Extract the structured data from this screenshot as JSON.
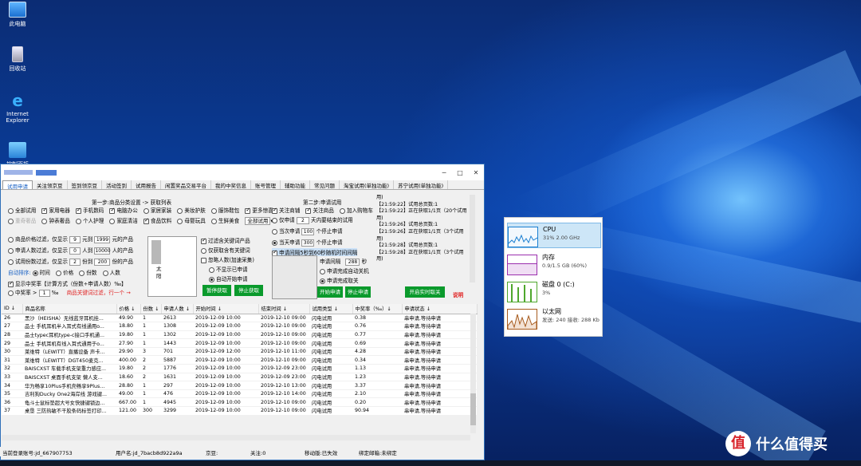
{
  "desktop": {
    "icons": [
      {
        "label": "此电脑",
        "icon": "computer-icon"
      },
      {
        "label": "回收站",
        "icon": "recycle-bin-icon"
      },
      {
        "label": "Internet Explorer",
        "icon": "ie-icon"
      },
      {
        "label": "控制面板",
        "icon": "control-panel-icon"
      }
    ]
  },
  "window": {
    "tabs": [
      "试用申请",
      "关注领京豆",
      "签到领京豆",
      "活动签到",
      "试用报告",
      "闲置奖品交易平台",
      "我的中奖信息",
      "账号管理",
      "辅助功能",
      "常见问题",
      "淘宝试用(单独功能)",
      "苏宁试用(单独功能)"
    ],
    "step1": {
      "title": "第一步:商品分类设置 -> 获取列表",
      "cats_row1": [
        "全部试用",
        "家用电器",
        "手机数码",
        "电脑办公",
        "家居家装",
        "美妆护肤",
        "服饰鞋包",
        "更多惊喜"
      ],
      "cats_row2": [
        "重奇奢品",
        "钟表奢品",
        "个人护理",
        "家庭清洁",
        "食品饮料",
        "母婴玩具",
        "生鲜美食"
      ],
      "select": "全部试用",
      "f1": {
        "label": "商品价格过滤，仅显示",
        "min": "9",
        "to": "元到",
        "max": "1999",
        "unit": "元的产品"
      },
      "f2": {
        "label": "申请人数过滤，仅显示",
        "min": "0",
        "to": "人到",
        "max": "10000",
        "unit": "人的产品"
      },
      "f3": {
        "label": "试用份数过滤，仅显示",
        "min": "2",
        "to": "份到",
        "max": "200",
        "unit": "份的产品"
      },
      "sort_label": "自动排序:",
      "sort": [
        "时间",
        "价格",
        "份数",
        "人数"
      ],
      "winrate": "显示中奖率【计算方式（份数÷申请人数）‰】",
      "winrate2": "中奖率 >",
      "winrate_val": "1",
      "winrate_unit": "‰",
      "tip": "商品关键词过滤，行一个 →",
      "keywords": [
        "小",
        "门",
        "箱",
        "头",
        "鼠",
        "太",
        "阳"
      ],
      "opts": [
        "过滤含关键词产品",
        "仅获取含有关键词",
        "忽略人数(加速采集)",
        "不显示已申请",
        "自动开始申请"
      ],
      "btn_pause": "暂停获取",
      "btn_stop": "停止获取"
    },
    "step2": {
      "title": "第二步:申请试用",
      "r1": [
        "关注商铺",
        "关注商品",
        "加入购物车"
      ],
      "only_apply": "仅申请",
      "only_apply_val": "2",
      "only_apply_unit": "天内要结束的试用",
      "day_apply": "当次申请",
      "day_apply_val": "100",
      "day_apply_unit": "个停止申请",
      "day_apply2": "当天申请",
      "day_apply2_val": "300",
      "day_apply2_unit": "个停止申请",
      "interval_label": "申请间隔5秒到",
      "interval_tail": "60秒随机时间间隔",
      "interval": "申请间隔",
      "interval_val": "288",
      "interval_unit": "秒",
      "after1": "申请完成自动关机",
      "after2": "申请完成取关",
      "btn_start": "开始申请",
      "btn_stop": "停止申请"
    },
    "log": [
      "用)",
      "【21:59:22】试用总页数:1",
      "【21:59:22】正在获取1/1页（20个试用",
      "用)",
      "【21:59:26】试用总页数:1",
      "【21:59:26】正在获取1/1页（3个试用",
      "用)",
      "【21:59:28】试用总页数:1",
      "【21:59:28】正在获取1/1页（3个试用",
      "用)"
    ],
    "btn_realtime": "开启实时取关",
    "help": "说明",
    "table": {
      "headers": [
        "ID ↓",
        "商品名称",
        "价格 ↓",
        "份数 ↓",
        "申请人数 ↓",
        "开始时间 ↓",
        "结束时间 ↓",
        "试用类型 ↓",
        "中奖率（‰）↓",
        "申请状态 ↓"
      ],
      "rows": [
        [
          "26",
          "黑沙（HEISHA）无线蓝牙耳机挂...",
          "49.90",
          "1",
          "2613",
          "2019-12-09 10:00",
          "2019-12-10 09:00",
          "闪电试用",
          "0.38",
          "串申请,等待申请"
        ],
        [
          "27",
          "品士 手机耳机半入耳式有线通用o...",
          "18.80",
          "1",
          "1308",
          "2019-12-09 10:00",
          "2019-12-10 09:00",
          "闪电试用",
          "0.76",
          "串申请,等待申请"
        ],
        [
          "28",
          "品士typec耳机type-c接口手机通...",
          "19.80",
          "1",
          "1302",
          "2019-12-09 10:00",
          "2019-12-10 09:00",
          "闪电试用",
          "0.77",
          "串申请,等待申请"
        ],
        [
          "29",
          "品士 手机耳机有线入耳式通用于o...",
          "27.90",
          "1",
          "1443",
          "2019-12-09 10:00",
          "2019-12-10 09:00",
          "闪电试用",
          "0.69",
          "串申请,等待申请"
        ],
        [
          "30",
          "莱维特（LEWITT）直播设备 声卡...",
          "29.90",
          "3",
          "701",
          "2019-12-09 12:00",
          "2019-12-10 11:00",
          "闪电试用",
          "4.28",
          "串申请,等待申请"
        ],
        [
          "31",
          "莱维特（LEWITT）DGT450麦克...",
          "400.00",
          "2",
          "5887",
          "2019-12-09 10:00",
          "2019-12-10 09:00",
          "闪电试用",
          "0.34",
          "串申请,等待申请"
        ],
        [
          "32",
          "BAISCXST 车载手机支架重力感应...",
          "19.80",
          "2",
          "1776",
          "2019-12-09 10:00",
          "2019-12-09 23:00",
          "闪电试用",
          "1.13",
          "串申请,等待申请"
        ],
        [
          "33",
          "BAISCXST 桌面手机支架 懒人支...",
          "18.60",
          "2",
          "1631",
          "2019-12-09 10:00",
          "2019-12-09 23:00",
          "闪电试用",
          "1.23",
          "串申请,等待申请"
        ],
        [
          "34",
          "华为畅享10Plus手机壳畅享9Plus...",
          "28.80",
          "1",
          "297",
          "2019-12-09 10:00",
          "2019-12-10 13:00",
          "闪电试用",
          "3.37",
          "串申请,等待申请"
        ],
        [
          "35",
          "吉利狗Ducky One2海岸线 游戏键...",
          "49.00",
          "1",
          "476",
          "2019-12-09 10:00",
          "2019-12-10 14:00",
          "闪电试用",
          "2.10",
          "串申请,等待申请"
        ],
        [
          "36",
          "龟斗士鼠标垫超大号女快捷键锁边...",
          "667.00",
          "1",
          "4945",
          "2019-12-09 10:00",
          "2019-12-10 09:00",
          "闪电试用",
          "0.20",
          "串申请,等待申请"
        ],
        [
          "37",
          "桌垦 三防热敏不干胶条码标签打印...",
          "121.00",
          "300",
          "3299",
          "2019-12-09 10:00",
          "2019-12-10 09:00",
          "闪电试用",
          "90.94",
          "串申请,等待申请"
        ]
      ]
    },
    "status": {
      "login": "当前登录账号:jd_667907753",
      "user": "用户名:jd_7bacb8d922a9a",
      "bean": "京豆:",
      "follow": "关注:0",
      "mobile": "移动版:已失效",
      "bind": "绑定邮箱:未绑定"
    }
  },
  "perf": {
    "items": [
      {
        "name": "CPU",
        "sub": "31%  2.00 GHz",
        "color": "#1b7fd1"
      },
      {
        "name": "内存",
        "sub": "0.9/1.5 GB (60%)",
        "color": "#9b2fae"
      },
      {
        "name": "磁盘 0 (C:)",
        "sub": "3%",
        "color": "#4ea72c"
      },
      {
        "name": "以太网",
        "sub": "发送: 240  接收: 288 Kb",
        "color": "#a75b1e"
      }
    ]
  },
  "watermark": "什么值得买"
}
